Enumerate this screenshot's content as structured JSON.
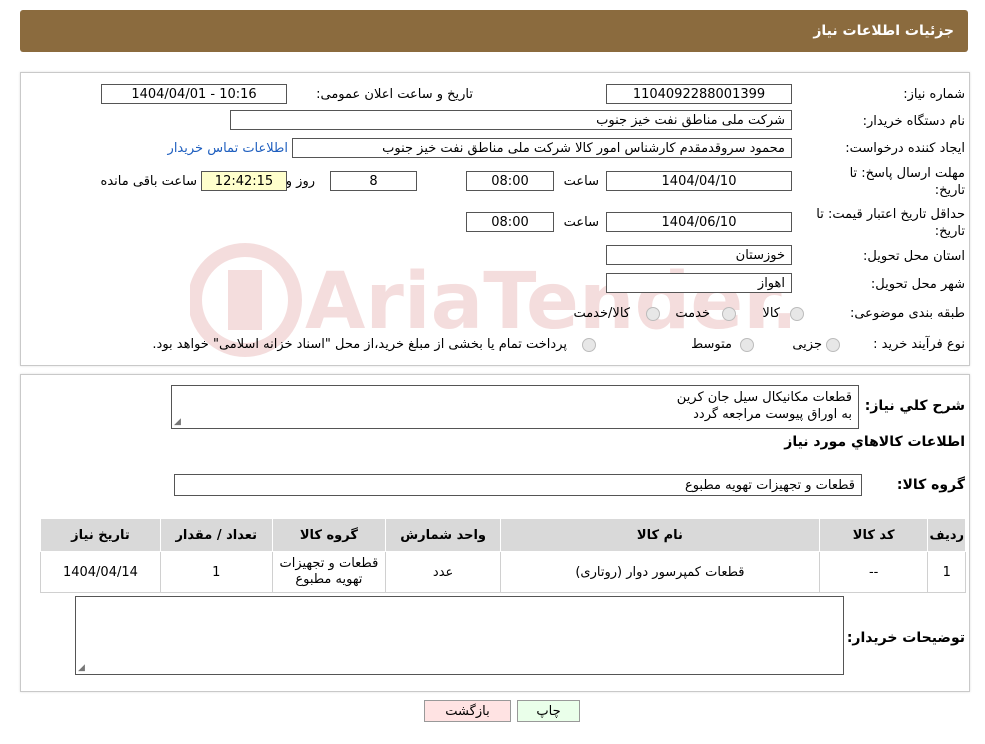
{
  "header": {
    "title": "جزئیات اطلاعات نیاز"
  },
  "form": {
    "need_number_label": "شماره نیاز:",
    "need_number": "1104092288001399",
    "announce_label": "تاریخ و ساعت اعلان عمومی:",
    "announce_value": "1404/04/01 - 10:16",
    "buyer_org_label": "نام دستگاه خریدار:",
    "buyer_org": "شرکت ملی مناطق نفت خیز جنوب",
    "creator_label": "ایجاد کننده درخواست:",
    "creator": "محمود سروقدمقدم کارشناس امور کالا شرکت ملی مناطق نفت خیز جنوب",
    "contact_link": "اطلاعات تماس خریدار",
    "deadline_label_1": "مهلت ارسال پاسخ: تا",
    "deadline_label_2": "تاریخ:",
    "deadline_date": "1404/04/10",
    "time_label": "ساعت",
    "deadline_time": "08:00",
    "days_value": "8",
    "days_label": "روز و",
    "remaining_time": "12:42:15",
    "remaining_label": "ساعت باقی مانده",
    "validity_label_1": "حداقل تاریخ اعتبار قیمت: تا",
    "validity_label_2": "تاریخ:",
    "validity_date": "1404/06/10",
    "validity_time": "08:00",
    "province_label": "استان محل تحویل:",
    "province": "خوزستان",
    "city_label": "شهر محل تحویل:",
    "city": "اهواز",
    "category_label": "طبقه بندی موضوعی:",
    "category_options": [
      "کالا",
      "خدمت",
      "کالا/خدمت"
    ],
    "purchase_type_label": "نوع فرآیند خرید :",
    "purchase_options": [
      "جزیی",
      "متوسط"
    ],
    "purchase_note": "پرداخت تمام یا بخشی از مبلغ خرید،از محل \"اسناد خزانه اسلامی\" خواهد بود."
  },
  "description": {
    "label": "شرح کلي نياز:",
    "line1": "قطعات مکانیکال سیل جان کرین",
    "line2": "به اوراق پیوست مراجعه گردد"
  },
  "goods": {
    "section_title": "اطلاعات کالاهاي مورد نياز",
    "group_label": "گروه کالا:",
    "group_value": "قطعات و تجهیزات تهویه مطبوع"
  },
  "table": {
    "headers": [
      "رديف",
      "کد کالا",
      "نام کالا",
      "واحد شمارش",
      "گروه کالا",
      "تعداد / مقدار",
      "تاريخ نياز"
    ],
    "rows": [
      [
        "1",
        "--",
        "قطعات کمپرسور دوار (روتاری)",
        "عدد",
        "قطعات و تجهیزات تهویه مطبوع",
        "1",
        "1404/04/14"
      ]
    ]
  },
  "buyer_notes": {
    "label": "توضیحات خریدار:"
  },
  "buttons": {
    "print": "چاپ",
    "back": "بازگشت"
  },
  "watermark": {
    "text": "AriaTender.neT"
  }
}
